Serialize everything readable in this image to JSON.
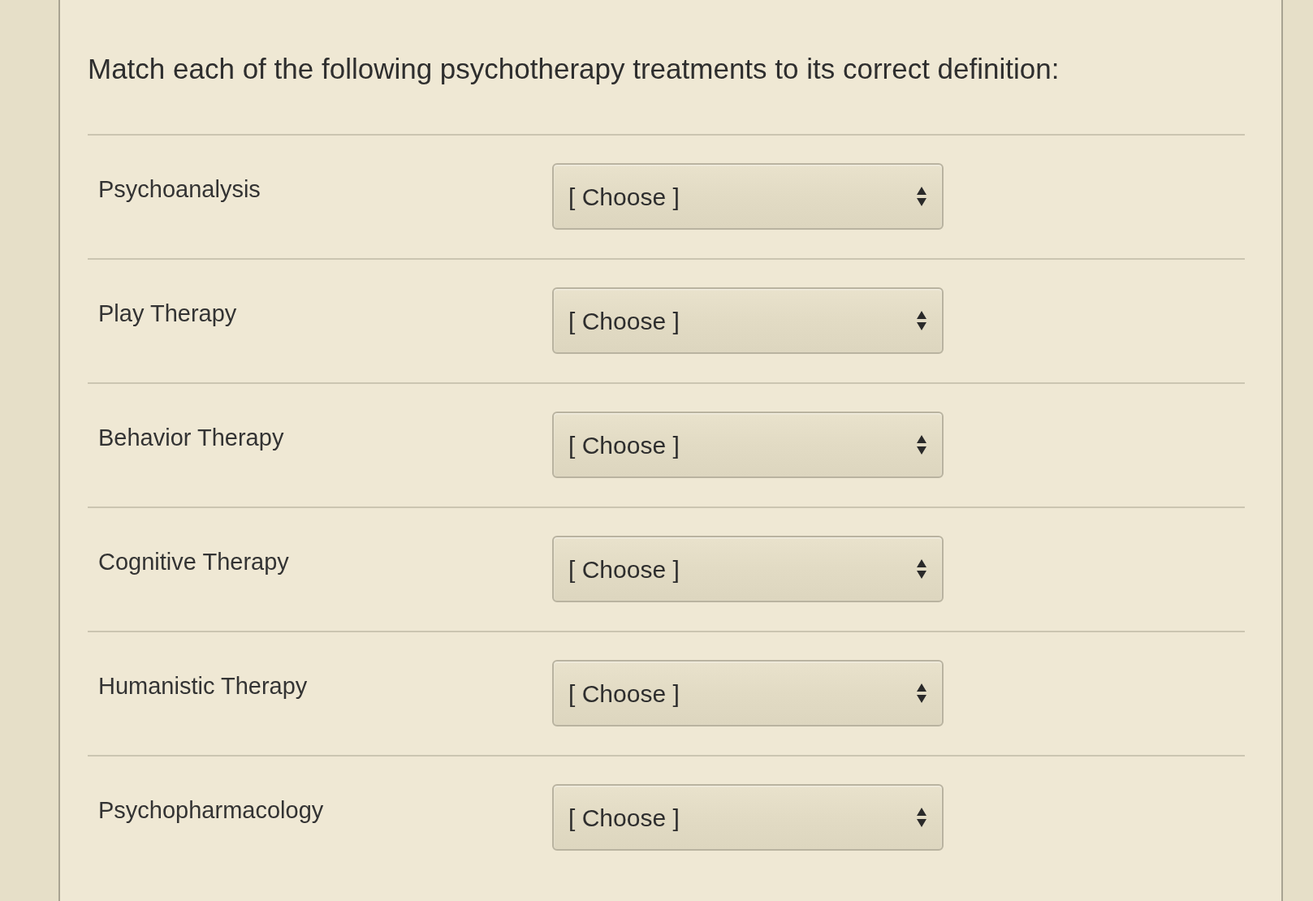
{
  "prompt": "Match each of the following psychotherapy treatments to its correct definition:",
  "rows": [
    {
      "term": "Psychoanalysis",
      "select": {
        "value": "[ Choose ]"
      }
    },
    {
      "term": "Play Therapy",
      "select": {
        "value": "[ Choose ]"
      }
    },
    {
      "term": "Behavior Therapy",
      "select": {
        "value": "[ Choose ]"
      }
    },
    {
      "term": "Cognitive Therapy",
      "select": {
        "value": "[ Choose ]"
      }
    },
    {
      "term": "Humanistic Therapy",
      "select": {
        "value": "[ Choose ]"
      }
    },
    {
      "term": "Psychopharmacology",
      "select": {
        "value": "[ Choose ]"
      }
    }
  ]
}
